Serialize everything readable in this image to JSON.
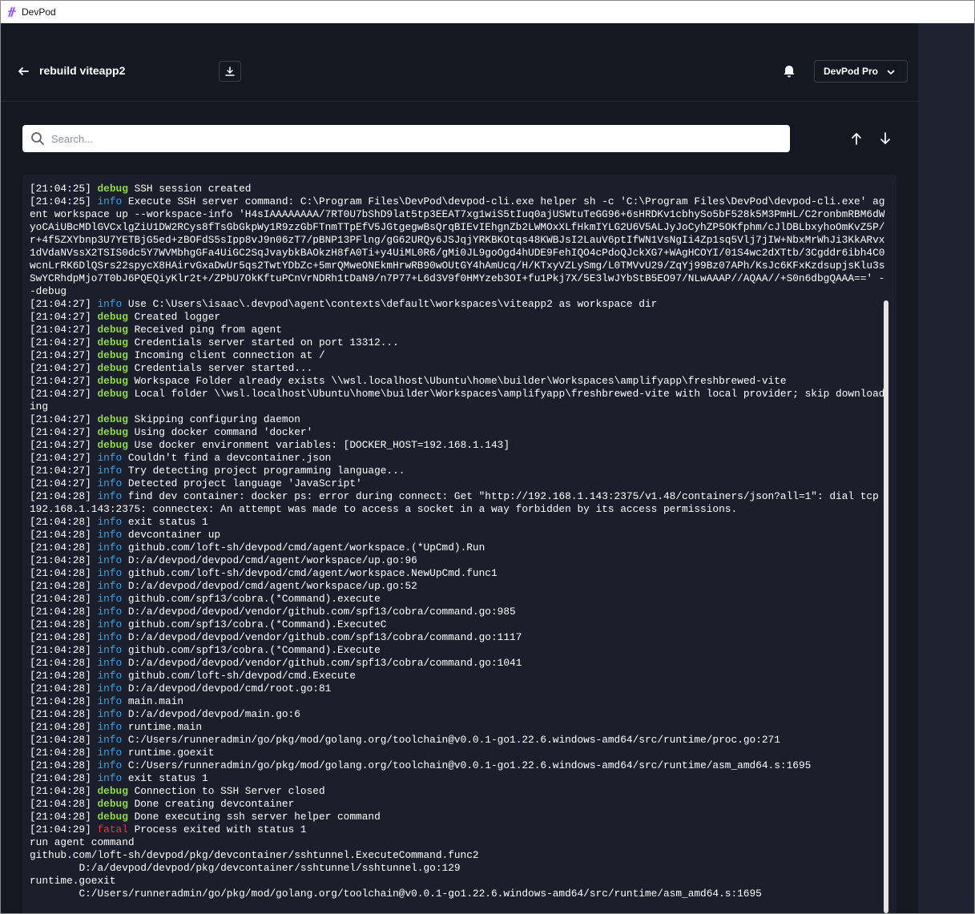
{
  "window": {
    "title": "DevPod"
  },
  "header": {
    "title": "rebuild viteapp2",
    "plan_label": "DevPod Pro"
  },
  "search": {
    "placeholder": "Search..."
  },
  "colors": {
    "debug": "#8cd94a",
    "info": "#3ba3e8",
    "fatal": "#e0364a"
  },
  "icons": {
    "back": "arrow-left-icon",
    "download": "download-icon",
    "notifications": "bell-icon",
    "plan_menu": "chevron-down-icon",
    "search": "search-icon",
    "prev": "arrow-up-icon",
    "next": "arrow-down-icon"
  },
  "logs": [
    {
      "ts": "[21:04:25]",
      "level": "debug",
      "msg": "SSH session created"
    },
    {
      "ts": "[21:04:25]",
      "level": "info",
      "msg": "Execute SSH server command: C:\\Program Files\\DevPod\\devpod-cli.exe helper sh -c 'C:\\Program Files\\DevPod\\devpod-cli.exe' agent workspace up --workspace-info 'H4sIAAAAAAAA/7RT0U7bShD9lat5tp3EEAT7xg1wiS5tIuq0ajUSWtuTeGG96+6sHRDKv1cbhySo5bF528k5M3PmHL/C2ronbmRBM6dWyoCAiUBcMDlGVCxlgZiU1DW2RCys8fTsGbGkpWy1R9zzGbFTnmTTpEfV5JGtgegwBsQrqBIEvIEhgnZb2LWMOxXLfHkmIYLG2U6V5ALJyJoCyhZP5OKfphm/cJlDBLbxyhoOmKvZ5P/r+4f5ZXYbnp3U7YETBjG5ed+zBOFdS5sIpp8vJ9n06zT7/pBNP13PFlng/gG62URQy6JSJqjYRKBKOtqs48KWBJsI2LauV6ptIfWN1VsNgIi4Zp1sq5Vlj7jIW+NbxMrWhJi3KkARvx1dVdaNVssX2TSIS0dc5Y7WVMbhgGFa4UiGC2SqJvaybkBAOkzH8fA0Ti+y4UiML0R6/gMi0JL9goOgd4hUDE9FehIQO4cPdoQJckXG7+WAgHCOYI/01S4wc2dXTtb/3Cgddr6ibh4C0wcnLrRK6DlQSrs22spycX8HAirvGxaDwUr5qs2TwtYDbZc+5mrQMweONEkmHrwRB90wOUtGY4hAmUcq/H/KTxyVZLySmg/L0TMVvU29/ZqYj99Bz07APh/KsJc6KFxKzdsupjsKlu3sSwYCRhdpMjo7T0bJ6PQEQiyKlr2t+/ZPbU7OkKftuPCnVrNDRh1tDaN9/n7P77+L6d3V9f0HMYzeb3OI+fu1Pkj7X/5E3lwJYbStB5EO97/NLwAAAP//AQAA//+S0n6dbgQAAA==' --debug"
    },
    {
      "ts": "[21:04:27]",
      "level": "info",
      "msg": "Use C:\\Users\\isaac\\.devpod\\agent\\contexts\\default\\workspaces\\viteapp2 as workspace dir"
    },
    {
      "ts": "[21:04:27]",
      "level": "debug",
      "msg": "Created logger"
    },
    {
      "ts": "[21:04:27]",
      "level": "debug",
      "msg": "Received ping from agent"
    },
    {
      "ts": "[21:04:27]",
      "level": "debug",
      "msg": "Credentials server started on port 13312..."
    },
    {
      "ts": "[21:04:27]",
      "level": "debug",
      "msg": "Incoming client connection at /"
    },
    {
      "ts": "[21:04:27]",
      "level": "debug",
      "msg": "Credentials server started..."
    },
    {
      "ts": "[21:04:27]",
      "level": "debug",
      "msg": "Workspace Folder already exists \\\\wsl.localhost\\Ubuntu\\home\\builder\\Workspaces\\amplifyapp\\freshbrewed-vite"
    },
    {
      "ts": "[21:04:27]",
      "level": "debug",
      "msg": "Local folder \\\\wsl.localhost\\Ubuntu\\home\\builder\\Workspaces\\amplifyapp\\freshbrewed-vite with local provider; skip downloading"
    },
    {
      "ts": "[21:04:27]",
      "level": "debug",
      "msg": "Skipping configuring daemon"
    },
    {
      "ts": "[21:04:27]",
      "level": "debug",
      "msg": "Using docker command 'docker'"
    },
    {
      "ts": "[21:04:27]",
      "level": "debug",
      "msg": "Use docker environment variables: [DOCKER_HOST=192.168.1.143]"
    },
    {
      "ts": "[21:04:27]",
      "level": "info",
      "msg": "Couldn't find a devcontainer.json"
    },
    {
      "ts": "[21:04:27]",
      "level": "info",
      "msg": "Try detecting project programming language..."
    },
    {
      "ts": "[21:04:27]",
      "level": "info",
      "msg": "Detected project language 'JavaScript'"
    },
    {
      "ts": "[21:04:28]",
      "level": "info",
      "msg": "find dev container: docker ps: error during connect: Get \"http://192.168.1.143:2375/v1.48/containers/json?all=1\": dial tcp 192.168.1.143:2375: connectex: An attempt was made to access a socket in a way forbidden by its access permissions."
    },
    {
      "ts": "[21:04:28]",
      "level": "info",
      "msg": "exit status 1"
    },
    {
      "ts": "[21:04:28]",
      "level": "info",
      "msg": "devcontainer up"
    },
    {
      "ts": "[21:04:28]",
      "level": "info",
      "msg": "github.com/loft-sh/devpod/cmd/agent/workspace.(*UpCmd).Run"
    },
    {
      "ts": "[21:04:28]",
      "level": "info",
      "msg": "D:/a/devpod/devpod/cmd/agent/workspace/up.go:96"
    },
    {
      "ts": "[21:04:28]",
      "level": "info",
      "msg": "github.com/loft-sh/devpod/cmd/agent/workspace.NewUpCmd.func1"
    },
    {
      "ts": "[21:04:28]",
      "level": "info",
      "msg": "D:/a/devpod/devpod/cmd/agent/workspace/up.go:52"
    },
    {
      "ts": "[21:04:28]",
      "level": "info",
      "msg": "github.com/spf13/cobra.(*Command).execute"
    },
    {
      "ts": "[21:04:28]",
      "level": "info",
      "msg": "D:/a/devpod/devpod/vendor/github.com/spf13/cobra/command.go:985"
    },
    {
      "ts": "[21:04:28]",
      "level": "info",
      "msg": "github.com/spf13/cobra.(*Command).ExecuteC"
    },
    {
      "ts": "[21:04:28]",
      "level": "info",
      "msg": "D:/a/devpod/devpod/vendor/github.com/spf13/cobra/command.go:1117"
    },
    {
      "ts": "[21:04:28]",
      "level": "info",
      "msg": "github.com/spf13/cobra.(*Command).Execute"
    },
    {
      "ts": "[21:04:28]",
      "level": "info",
      "msg": "D:/a/devpod/devpod/vendor/github.com/spf13/cobra/command.go:1041"
    },
    {
      "ts": "[21:04:28]",
      "level": "info",
      "msg": "github.com/loft-sh/devpod/cmd.Execute"
    },
    {
      "ts": "[21:04:28]",
      "level": "info",
      "msg": "D:/a/devpod/devpod/cmd/root.go:81"
    },
    {
      "ts": "[21:04:28]",
      "level": "info",
      "msg": "main.main"
    },
    {
      "ts": "[21:04:28]",
      "level": "info",
      "msg": "D:/a/devpod/devpod/main.go:6"
    },
    {
      "ts": "[21:04:28]",
      "level": "info",
      "msg": "runtime.main"
    },
    {
      "ts": "[21:04:28]",
      "level": "info",
      "msg": "C:/Users/runneradmin/go/pkg/mod/golang.org/toolchain@v0.0.1-go1.22.6.windows-amd64/src/runtime/proc.go:271"
    },
    {
      "ts": "[21:04:28]",
      "level": "info",
      "msg": "runtime.goexit"
    },
    {
      "ts": "[21:04:28]",
      "level": "info",
      "msg": "C:/Users/runneradmin/go/pkg/mod/golang.org/toolchain@v0.0.1-go1.22.6.windows-amd64/src/runtime/asm_amd64.s:1695"
    },
    {
      "ts": "[21:04:28]",
      "level": "info",
      "msg": "exit status 1"
    },
    {
      "ts": "[21:04:28]",
      "level": "debug",
      "msg": "Connection to SSH Server closed"
    },
    {
      "ts": "[21:04:28]",
      "level": "debug",
      "msg": "Done creating devcontainer"
    },
    {
      "ts": "[21:04:28]",
      "level": "debug",
      "msg": "Done executing ssh server helper command"
    },
    {
      "ts": "[21:04:29]",
      "level": "fatal",
      "msg": "Process exited with status 1"
    },
    {
      "ts": "",
      "level": "",
      "msg": "run agent command"
    },
    {
      "ts": "",
      "level": "",
      "msg": "github.com/loft-sh/devpod/pkg/devcontainer/sshtunnel.ExecuteCommand.func2"
    },
    {
      "ts": "",
      "level": "",
      "msg": "\tD:/a/devpod/devpod/pkg/devcontainer/sshtunnel/sshtunnel.go:129"
    },
    {
      "ts": "",
      "level": "",
      "msg": "runtime.goexit"
    },
    {
      "ts": "",
      "level": "",
      "msg": "\tC:/Users/runneradmin/go/pkg/mod/golang.org/toolchain@v0.0.1-go1.22.6.windows-amd64/src/runtime/asm_amd64.s:1695"
    }
  ]
}
